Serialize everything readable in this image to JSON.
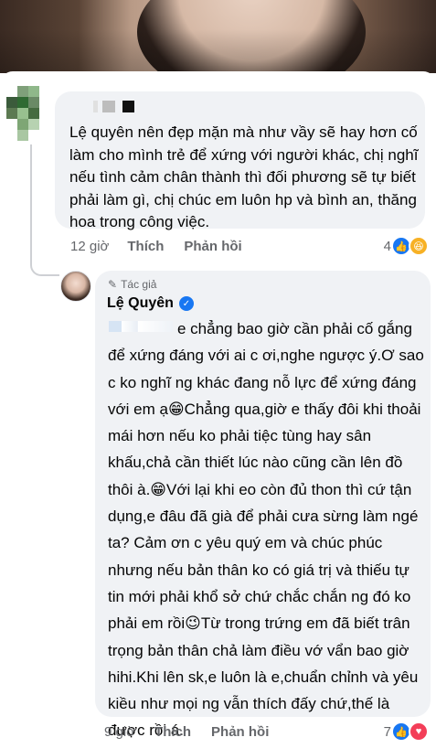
{
  "comment1": {
    "text": "Lệ quyên nên đẹp mặn mà như vầy sẽ hay hơn cố làm cho mình trẻ để xứng với người khác, chị nghĩ nếu tình cảm chân thành thì đối phương sẽ tự biết phải làm gì, chị chúc em luôn hp và bình an, thăng hoa trong công việc.",
    "time": "12 giờ",
    "like_label": "Thích",
    "reply_label": "Phản hồi",
    "reaction_count": "4",
    "reactions": [
      "like-icon",
      "haha-icon"
    ]
  },
  "reply": {
    "badge": "Tác giả",
    "author": "Lệ Quyên",
    "text": "e chẳng bao giờ cần phải cố gắng để xứng đáng với ai c ơi,nghe ngược ý.Ơ sao c ko nghĩ ng khác đang nỗ lực để xứng đáng với em ạ😁Chẳng qua,giờ e thấy đôi khi thoải mái hơn nếu ko phải tiệc tùng hay sân khấu,chả cần thiết lúc nào cũng cần lên đồ thôi à.😁Với lại khi eo còn đủ thon thì cứ tận dụng,e đâu đã già để phải cưa sừng làm ngé ta? Cảm ơn c yêu quý em và chúc phúc nhưng nếu bản thân ko có giá trị và thiếu tự tin mới phải khổ sở chứ chắc chắn ng đó ko phải em rồi😉Từ trong trứng em đã biết trân trọng bản thân chả làm điều vớ vẩn bao giờ hihi.Khi lên sk,e luôn là e,chuẩn chỉnh và yêu kiều như mọi ng vẫn thích đấy chứ,thế là được rồi á.",
    "time": "9 giờ",
    "like_label": "Thích",
    "reply_label": "Phản hồi",
    "reaction_count": "7",
    "reactions": [
      "like-icon",
      "love-icon"
    ]
  },
  "colors": {
    "bubble": "#f0f2f5",
    "meta_text": "#65676b",
    "like_blue": "#1877f2",
    "love_red": "#f33e58",
    "haha_yellow": "#f7b125"
  }
}
